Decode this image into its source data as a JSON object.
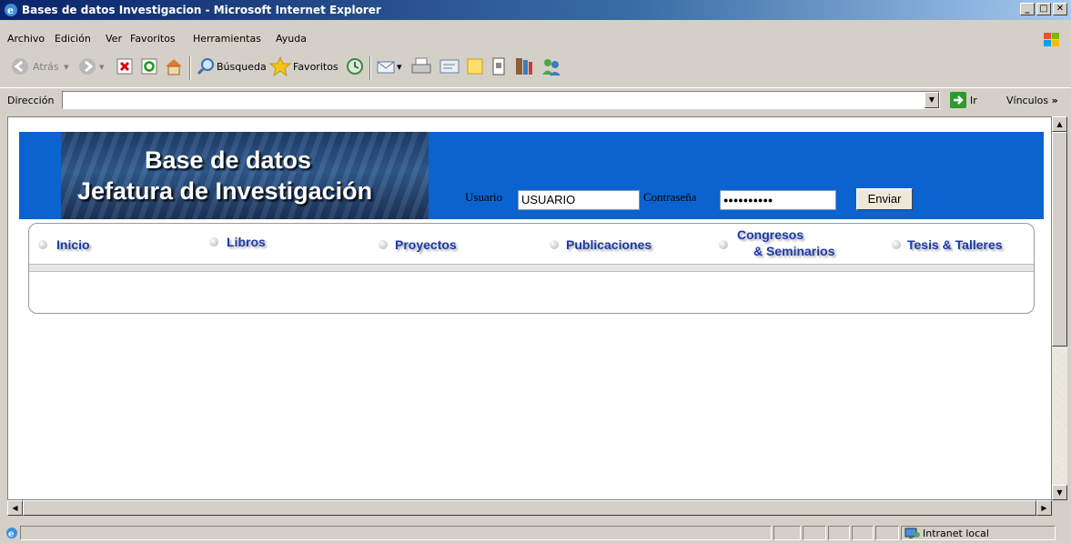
{
  "window": {
    "title": "Bases de datos Investigacion - Microsoft Internet Explorer",
    "buttons": {
      "minimize": "_",
      "maximize": "□",
      "close": "✕"
    }
  },
  "menubar": [
    "Archivo",
    "Edición",
    "Ver",
    "Favoritos",
    "Herramientas",
    "Ayuda"
  ],
  "toolbar": {
    "back_label": "Atrás",
    "search_label": "Búsqueda",
    "favorites_label": "Favoritos"
  },
  "address": {
    "label": "Dirección",
    "value": "",
    "go_label": "Ir",
    "links_label": "Vínculos"
  },
  "page": {
    "banner_line1": "Base de datos",
    "banner_line2": "Jefatura de Investigación",
    "login": {
      "user_label": "Usuario",
      "user_value": "USUARIO",
      "password_label": "Contraseña",
      "password_mask": "●●●●●●●●●●",
      "submit_label": "Enviar"
    },
    "nav": {
      "inicio": "Inicio",
      "libros": "Libros",
      "proyectos": "Proyectos",
      "publicaciones": "Publicaciones",
      "congresos_1": "Congresos",
      "congresos_2": "& Seminarios",
      "tesis": "Tesis & Talleres"
    }
  },
  "status": {
    "zone": "Intranet local"
  }
}
